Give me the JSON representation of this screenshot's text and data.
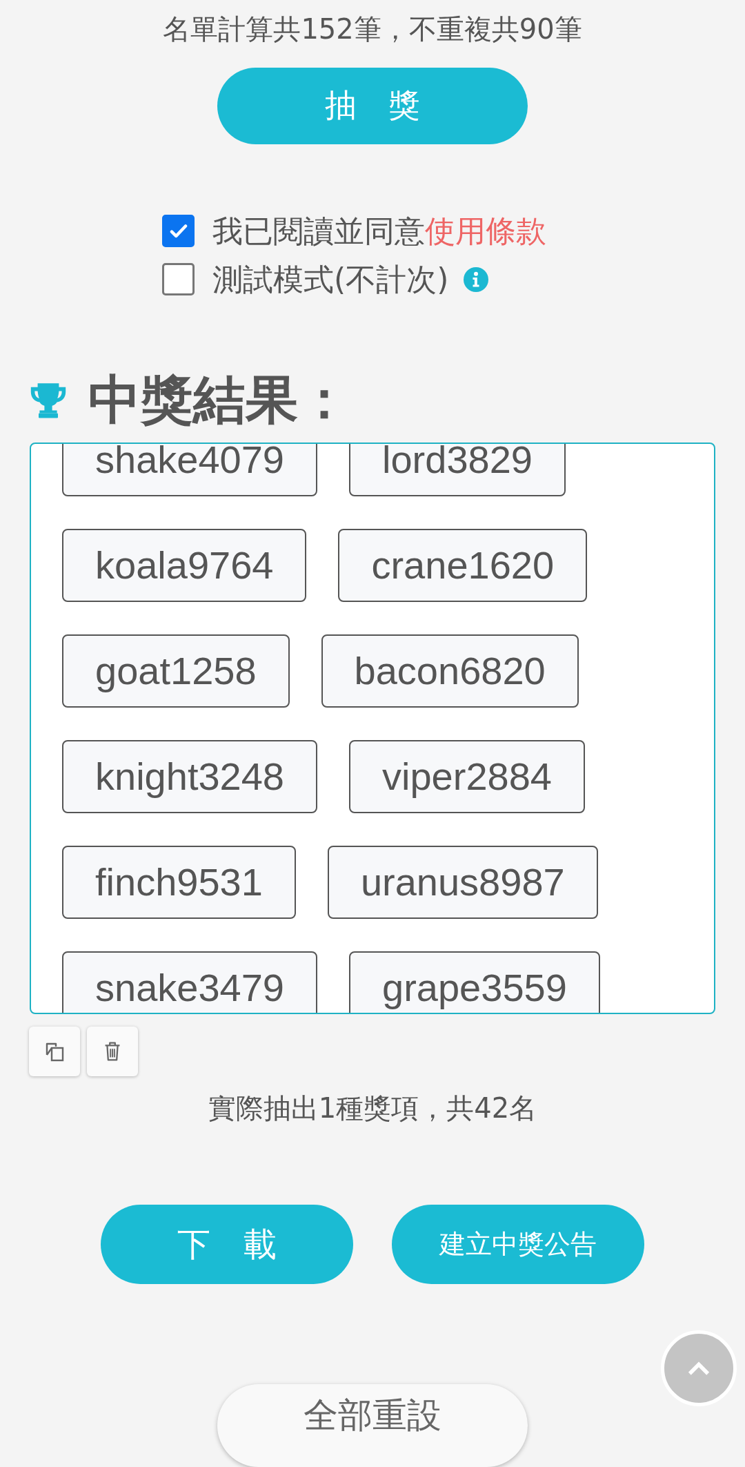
{
  "summary": "名單計算共152筆，不重複共90筆",
  "draw_button": "抽　獎",
  "checkboxes": [
    {
      "label": "我已閱讀並同意",
      "link": "使用條款",
      "checked": true
    },
    {
      "label": "測試模式(不計次)",
      "checked": false,
      "info": true
    }
  ],
  "results": {
    "title": "中獎結果：",
    "winners": [
      "shake4079",
      "lord3829",
      "koala9764",
      "crane1620",
      "goat1258",
      "bacon6820",
      "knight3248",
      "viper2884",
      "finch9531",
      "uranus8987",
      "snake3479",
      "grape3559"
    ]
  },
  "result_summary": "實際抽出1種獎項，共42名",
  "buttons": [
    "下　載",
    "建立中獎公告"
  ],
  "reset_button": "全部重設"
}
